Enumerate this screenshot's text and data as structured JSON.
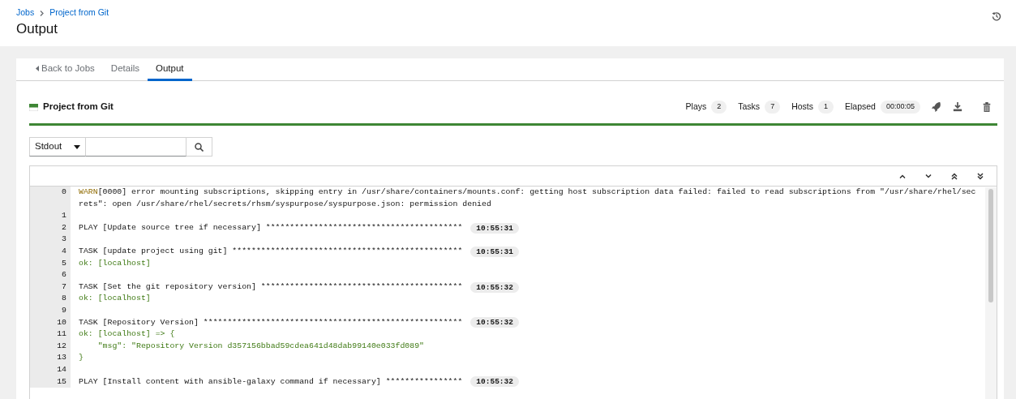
{
  "breadcrumb": [
    {
      "label": "Jobs"
    },
    {
      "label": "Project from Git"
    }
  ],
  "page_title": "Output",
  "tabs": [
    {
      "label": "Back to Jobs",
      "kind": "back",
      "selected": false
    },
    {
      "label": "Details",
      "kind": "tab",
      "selected": false
    },
    {
      "label": "Output",
      "kind": "tab",
      "selected": true
    }
  ],
  "job": {
    "name": "Project from Git",
    "kind": "successful",
    "progress": {
      "level": 1
    },
    "stats": [
      {
        "label": "Plays",
        "value": "2"
      },
      {
        "label": "Tasks",
        "value": "7"
      },
      {
        "label": "Hosts",
        "value": "1"
      },
      {
        "label": "Elapsed",
        "value": "00:00:05"
      }
    ]
  },
  "search": {
    "filter": "Stdout"
  },
  "log": {
    "lines": [
      {
        "number": "0",
        "segments": [
          {
            "kind": "warn",
            "text": "WARN"
          },
          {
            "kind": "plain",
            "text": "[0000] error mounting subscriptions, skipping entry in /usr/share/containers/mounts.conf: getting host subscription data failed: failed to read subscriptions from \"/usr/share/rhel/secrets\": open /usr/share/rhel/secrets/rhsm/syspurpose/syspurpose.json: permission denied"
          }
        ]
      },
      {
        "number": "1"
      },
      {
        "number": "2",
        "segments": [
          {
            "kind": "plain",
            "text": "PLAY [Update source tree if necessary] *****************************************"
          }
        ],
        "time": "10:55:31"
      },
      {
        "number": "3"
      },
      {
        "number": "4",
        "segments": [
          {
            "kind": "plain",
            "text": "TASK [update project using git] ************************************************"
          }
        ],
        "time": "10:55:31"
      },
      {
        "number": "5",
        "segments": [
          {
            "kind": "ok",
            "text": "ok: [localhost]"
          }
        ]
      },
      {
        "number": "6"
      },
      {
        "number": "7",
        "segments": [
          {
            "kind": "plain",
            "text": "TASK [Set the git repository version] ******************************************"
          }
        ],
        "time": "10:55:32"
      },
      {
        "number": "8",
        "segments": [
          {
            "kind": "ok",
            "text": "ok: [localhost]"
          }
        ]
      },
      {
        "number": "9"
      },
      {
        "number": "10",
        "segments": [
          {
            "kind": "plain",
            "text": "TASK [Repository Version] ******************************************************"
          }
        ],
        "time": "10:55:32"
      },
      {
        "number": "11",
        "segments": [
          {
            "kind": "ok",
            "text": "ok: [localhost] => {"
          }
        ]
      },
      {
        "number": "12",
        "segments": [
          {
            "kind": "ok",
            "text": "    \"msg\": \"Repository Version d357156bbad59cdea641d48dab99140e033fd089\""
          }
        ]
      },
      {
        "number": "13",
        "segments": [
          {
            "kind": "ok",
            "text": "}"
          }
        ]
      },
      {
        "number": "14"
      },
      {
        "number": "15",
        "segments": [
          {
            "kind": "plain",
            "text": "PLAY [Install content with ansible-galaxy command if necessary] ****************"
          }
        ],
        "time": "10:55:32"
      }
    ]
  }
}
